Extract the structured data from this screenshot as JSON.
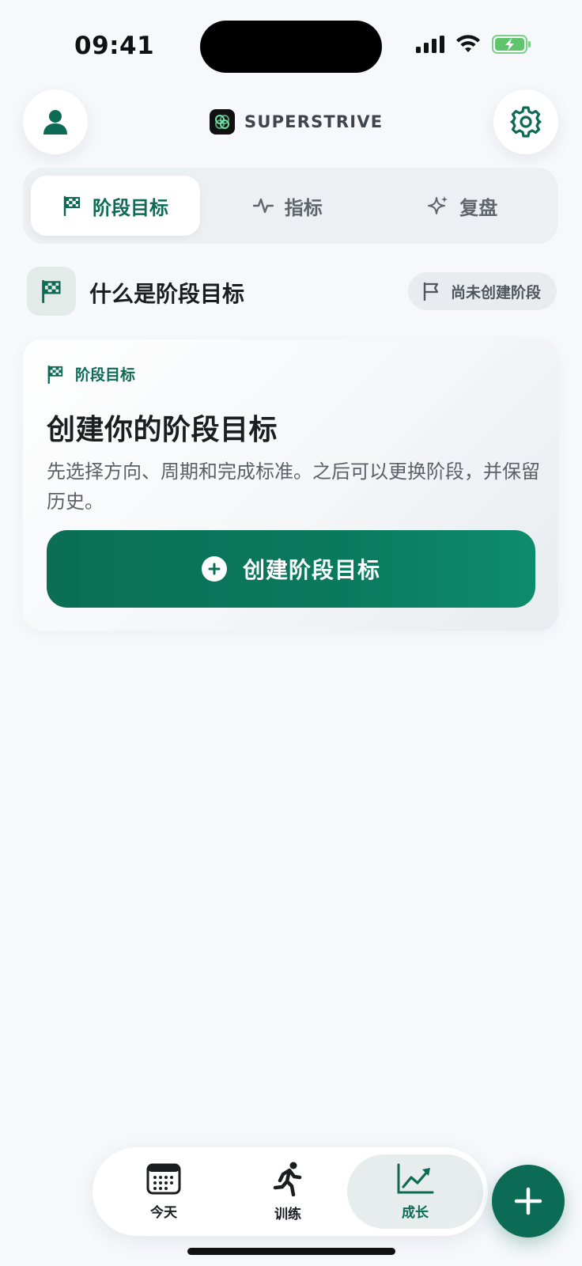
{
  "status_bar": {
    "time": "09:41"
  },
  "header": {
    "brand_name": "SUPERSTRIVE"
  },
  "tabs": [
    {
      "label": "阶段目标",
      "icon": "checkered-flag-icon",
      "active": true
    },
    {
      "label": "指标",
      "icon": "pulse-icon",
      "active": false
    },
    {
      "label": "复盘",
      "icon": "sparkle-icon",
      "active": false
    }
  ],
  "section": {
    "title": "什么是阶段目标",
    "status_pill": "尚未创建阶段"
  },
  "card": {
    "badge": "阶段目标",
    "title": "创建你的阶段目标",
    "description": "先选择方向、周期和完成标准。之后可以更换阶段，并保留历史。",
    "button_label": "创建阶段目标"
  },
  "bottom_nav": [
    {
      "label": "今天",
      "icon": "calendar-icon",
      "active": false
    },
    {
      "label": "训练",
      "icon": "running-figure-icon",
      "active": false
    },
    {
      "label": "成长",
      "icon": "growth-chart-icon",
      "active": true
    }
  ],
  "colors": {
    "accent": "#0d6b55",
    "background": "#f6f8fb",
    "fab": "#0c6b54"
  }
}
